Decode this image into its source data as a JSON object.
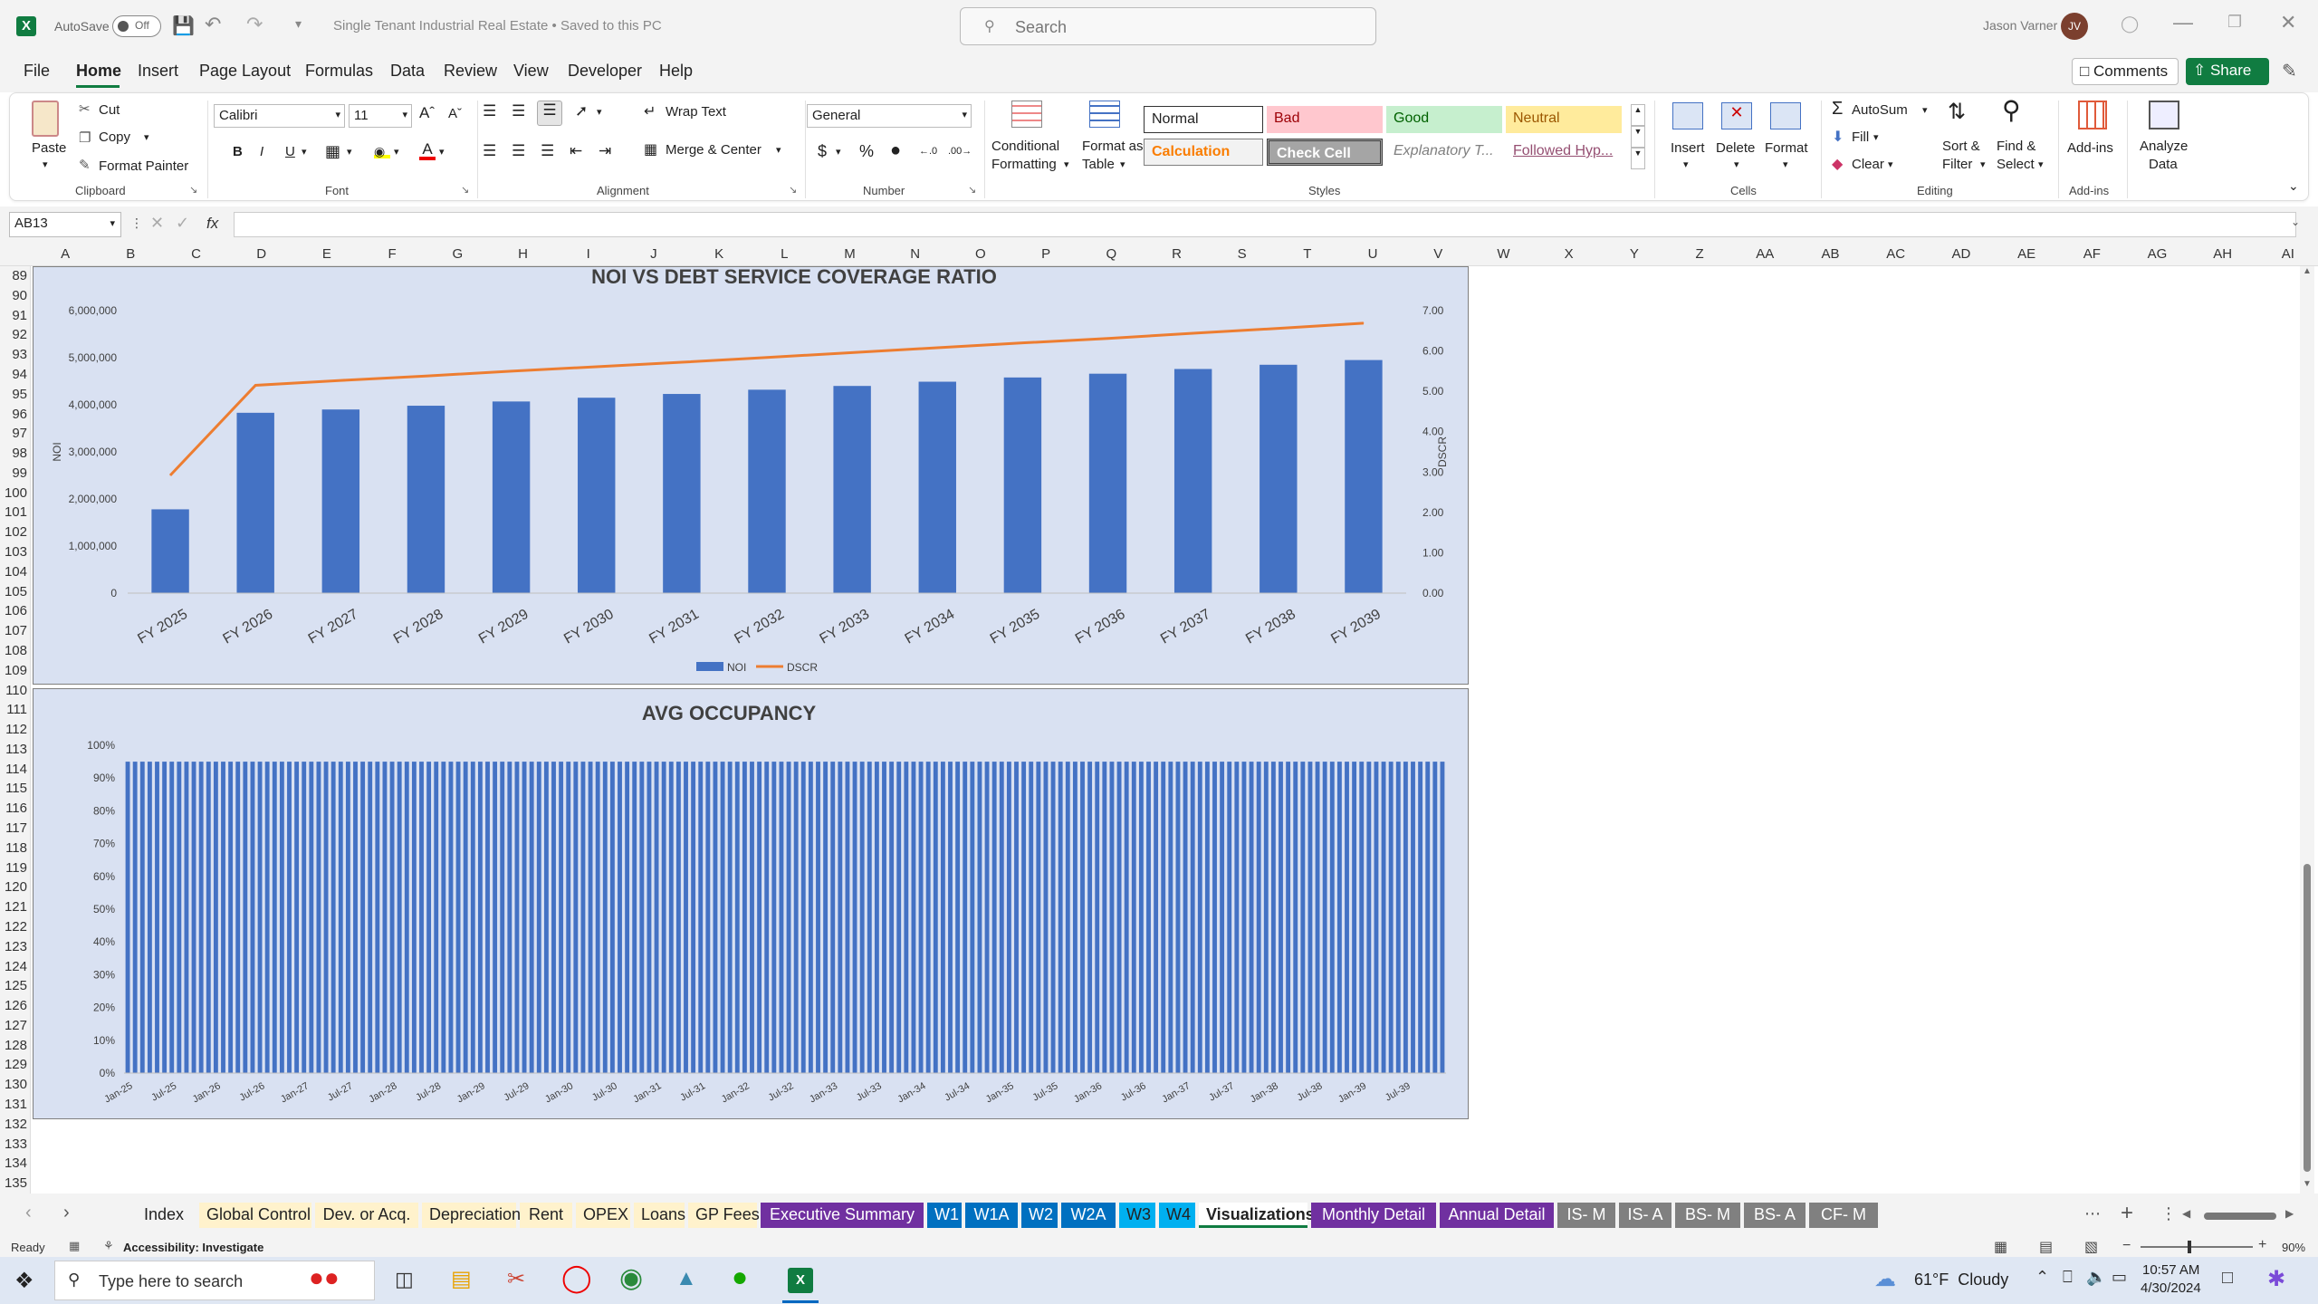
{
  "titlebar": {
    "autosave_label": "AutoSave",
    "autosave_state": "Off",
    "doc_title": "Single Tenant Industrial Real Estate • Saved to this PC",
    "search_placeholder": "Search",
    "user_name": "Jason Varner",
    "user_initials": "JV"
  },
  "menu": [
    "File",
    "Home",
    "Insert",
    "Page Layout",
    "Formulas",
    "Data",
    "Review",
    "View",
    "Developer",
    "Help"
  ],
  "menu_right": {
    "comments": "Comments",
    "share": "Share"
  },
  "ribbon": {
    "paste": "Paste",
    "cut": "Cut",
    "copy": "Copy",
    "format_painter": "Format Painter",
    "clipboard": "Clipboard",
    "font_name": "Calibri",
    "font_size": "11",
    "font": "Font",
    "wrap_text": "Wrap Text",
    "merge_center": "Merge & Center",
    "alignment": "Alignment",
    "number_format": "General",
    "number": "Number",
    "conditional_formatting": [
      "Conditional",
      "Formatting"
    ],
    "format_as_table": [
      "Format as",
      "Table"
    ],
    "styles_row1": [
      "Normal",
      "Bad",
      "Good",
      "Neutral"
    ],
    "styles_row2": [
      "Calculation",
      "Check Cell",
      "Explanatory T...",
      "Followed Hyp..."
    ],
    "styles": "Styles",
    "insert": "Insert",
    "delete": "Delete",
    "format": "Format",
    "cells": "Cells",
    "autosum": "AutoSum",
    "fill": "Fill",
    "clear": "Clear",
    "sort_filter": [
      "Sort &",
      "Filter"
    ],
    "find_select": [
      "Find &",
      "Select"
    ],
    "editing": "Editing",
    "addins": "Add-ins",
    "addins_group": "Add-ins",
    "analyze_data": [
      "Analyze",
      "Data"
    ]
  },
  "formula_bar": {
    "name_box": "AB13",
    "fx": "fx"
  },
  "columns": [
    "A",
    "B",
    "C",
    "D",
    "E",
    "F",
    "G",
    "H",
    "I",
    "J",
    "K",
    "L",
    "M",
    "N",
    "O",
    "P",
    "Q",
    "R",
    "S",
    "T",
    "U",
    "V",
    "W",
    "X",
    "Y",
    "Z",
    "AA",
    "AB",
    "AC",
    "AD",
    "AE",
    "AF",
    "AG",
    "AH",
    "AI"
  ],
  "rows": [
    "89",
    "90",
    "91",
    "92",
    "93",
    "94",
    "95",
    "96",
    "97",
    "98",
    "99",
    "100",
    "101",
    "102",
    "103",
    "104",
    "105",
    "106",
    "107",
    "108",
    "109",
    "110",
    "111",
    "112",
    "113",
    "114",
    "115",
    "116",
    "117",
    "118",
    "119",
    "120",
    "121",
    "122",
    "123",
    "124",
    "125",
    "126",
    "127",
    "128",
    "129",
    "130",
    "131",
    "132",
    "133",
    "134",
    "135"
  ],
  "chart_data": [
    {
      "type": "bar",
      "title": "NOI VS DEBT SERVICE COVERAGE RATIO",
      "categories": [
        "FY 2025",
        "FY 2026",
        "FY 2027",
        "FY 2028",
        "FY 2029",
        "FY 2030",
        "FY 2031",
        "FY 2032",
        "FY 2033",
        "FY 2034",
        "FY 2035",
        "FY 2036",
        "FY 2037",
        "FY 2038",
        "FY 2039"
      ],
      "ylabel": "NOI",
      "y2label": "DSCR",
      "ylim": [
        0,
        6000000
      ],
      "y2lim": [
        0,
        7
      ],
      "yticks": [
        "6,000,000",
        "5,000,000",
        "4,000,000",
        "3,000,000",
        "2,000,000",
        "1,000,000",
        "0"
      ],
      "y2ticks": [
        "7.00",
        "6.00",
        "5.00",
        "4.00",
        "3.00",
        "2.00",
        "1.00",
        "0.00"
      ],
      "series": [
        {
          "name": "NOI",
          "type": "bar",
          "color": "#4472c4",
          "values": [
            1780000,
            3830000,
            3900000,
            3980000,
            4070000,
            4150000,
            4230000,
            4320000,
            4400000,
            4490000,
            4580000,
            4660000,
            4760000,
            4850000,
            4950000
          ]
        },
        {
          "name": "DSCR",
          "type": "line",
          "color": "#ed7d31",
          "values": [
            2.92,
            5.15,
            5.27,
            5.38,
            5.5,
            5.61,
            5.72,
            5.84,
            5.96,
            6.08,
            6.2,
            6.31,
            6.44,
            6.56,
            6.69
          ]
        }
      ],
      "legend": "bottom"
    },
    {
      "type": "bar",
      "title": "AVG OCCUPANCY",
      "ylim": [
        0,
        1
      ],
      "yticks": [
        "100%",
        "90%",
        "80%",
        "70%",
        "60%",
        "50%",
        "40%",
        "30%",
        "20%",
        "10%",
        "0%"
      ],
      "xticks": [
        "Jan-25",
        "Jul-25",
        "Jan-26",
        "Jul-26",
        "Jan-27",
        "Jul-27",
        "Jan-28",
        "Jul-28",
        "Jan-29",
        "Jul-29",
        "Jan-30",
        "Jul-30",
        "Jan-31",
        "Jul-31",
        "Jan-32",
        "Jul-32",
        "Jan-33",
        "Jul-33",
        "Jan-34",
        "Jul-34",
        "Jan-35",
        "Jul-35",
        "Jan-36",
        "Jul-36",
        "Jan-37",
        "Jul-37",
        "Jan-38",
        "Jul-38",
        "Jan-39",
        "Jul-39"
      ],
      "bar_count": 180,
      "value": 0.95,
      "color": "#4472c4"
    }
  ],
  "sheet_tabs": [
    {
      "label": "Index",
      "bg": "#f3f3f3",
      "fg": "#222"
    },
    {
      "label": "Global Control",
      "bg": "#fff2cc",
      "fg": "#222"
    },
    {
      "label": "Dev. or Acq.",
      "bg": "#fff2cc",
      "fg": "#222"
    },
    {
      "label": "Depreciation",
      "bg": "#fff2cc",
      "fg": "#222"
    },
    {
      "label": "Rent",
      "bg": "#fff2cc",
      "fg": "#222"
    },
    {
      "label": "OPEX",
      "bg": "#fff2cc",
      "fg": "#222"
    },
    {
      "label": "Loans",
      "bg": "#fff2cc",
      "fg": "#222"
    },
    {
      "label": "GP Fees",
      "bg": "#fff2cc",
      "fg": "#222"
    },
    {
      "label": "Executive Summary",
      "bg": "#7030a0",
      "fg": "#fff"
    },
    {
      "label": "W1",
      "bg": "#0070c0",
      "fg": "#fff"
    },
    {
      "label": "W1A",
      "bg": "#0070c0",
      "fg": "#fff"
    },
    {
      "label": "W2",
      "bg": "#0070c0",
      "fg": "#fff"
    },
    {
      "label": "W2A",
      "bg": "#0070c0",
      "fg": "#fff"
    },
    {
      "label": "W3",
      "bg": "#00b0f0",
      "fg": "#222"
    },
    {
      "label": "W4",
      "bg": "#00b0f0",
      "fg": "#222"
    },
    {
      "label": "Visualizations",
      "bg": "#fff",
      "fg": "#222"
    },
    {
      "label": "Monthly Detail",
      "bg": "#7030a0",
      "fg": "#fff"
    },
    {
      "label": "Annual Detail",
      "bg": "#7030a0",
      "fg": "#fff"
    },
    {
      "label": "IS- M",
      "bg": "#808080",
      "fg": "#fff"
    },
    {
      "label": "IS- A",
      "bg": "#808080",
      "fg": "#fff"
    },
    {
      "label": "BS- M",
      "bg": "#808080",
      "fg": "#fff"
    },
    {
      "label": "BS- A",
      "bg": "#808080",
      "fg": "#fff"
    },
    {
      "label": "CF- M",
      "bg": "#808080",
      "fg": "#fff"
    }
  ],
  "status": {
    "ready": "Ready",
    "accessibility": "Accessibility: Investigate",
    "zoom": "90%"
  },
  "taskbar": {
    "search_placeholder": "Type here to search",
    "weather": "61°F  Cloudy",
    "time": "10:57 AM",
    "date": "4/30/2024"
  }
}
